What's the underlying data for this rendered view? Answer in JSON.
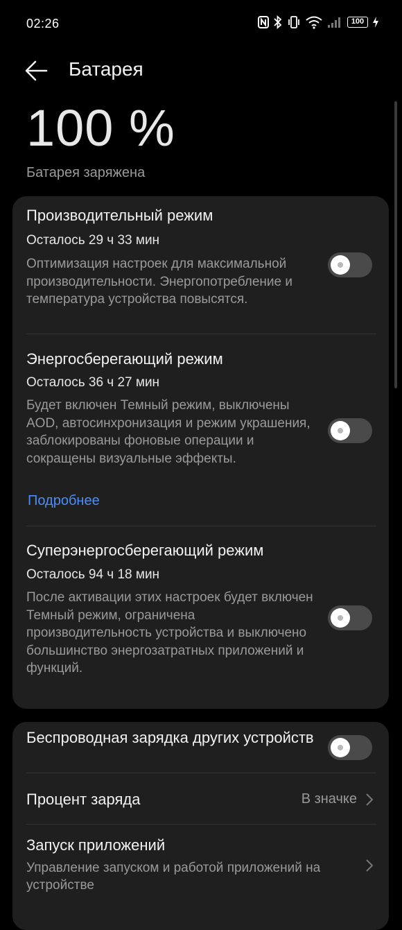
{
  "status_bar": {
    "time": "02:26",
    "battery_level": "100",
    "icons": [
      "nfc-icon",
      "bluetooth-icon",
      "vibrate-icon",
      "wifi-icon",
      "signal-icon",
      "battery-icon",
      "charging-icon"
    ]
  },
  "header": {
    "title": "Батарея",
    "back_icon": "arrow-left-icon"
  },
  "battery": {
    "percent": "100 %",
    "status": "Батарея заряжена"
  },
  "modes": [
    {
      "title": "Производительный режим",
      "remaining": "Осталось 29 ч 33 мин",
      "description": "Оптимизация настроек для максимальной производительности. Энергопотребление и температура устройства повысятся.",
      "enabled": false
    },
    {
      "title": "Энергосберегающий режим",
      "remaining": "Осталось 36 ч 27 мин",
      "description": "Будет включен Темный режим, выключены AOD, автосинхронизация и режим украшения, заблокированы фоновые операции и сокращены визуальные эффекты.",
      "link": "Подробнее",
      "enabled": false
    },
    {
      "title": "Суперэнергосберегающий режим",
      "remaining": "Осталось 94 ч 18 мин",
      "description": "После активации этих настроек будет включен Темный режим, ограничена производительность устройства и выключено большинство энергозатратных приложений и функций.",
      "enabled": false
    }
  ],
  "settings": {
    "wireless_sharing": {
      "title": "Беспроводная зарядка других устройств",
      "enabled": false
    },
    "charge_percent": {
      "title": "Процент заряда",
      "value": "В значке"
    },
    "app_launch": {
      "title": "Запуск приложений",
      "description": "Управление запуском и работой приложений на устройстве"
    }
  },
  "colors": {
    "background": "#000000",
    "card": "#1f1f1f",
    "link": "#4c8ef7",
    "toggle_off": "#4a4a4a"
  }
}
